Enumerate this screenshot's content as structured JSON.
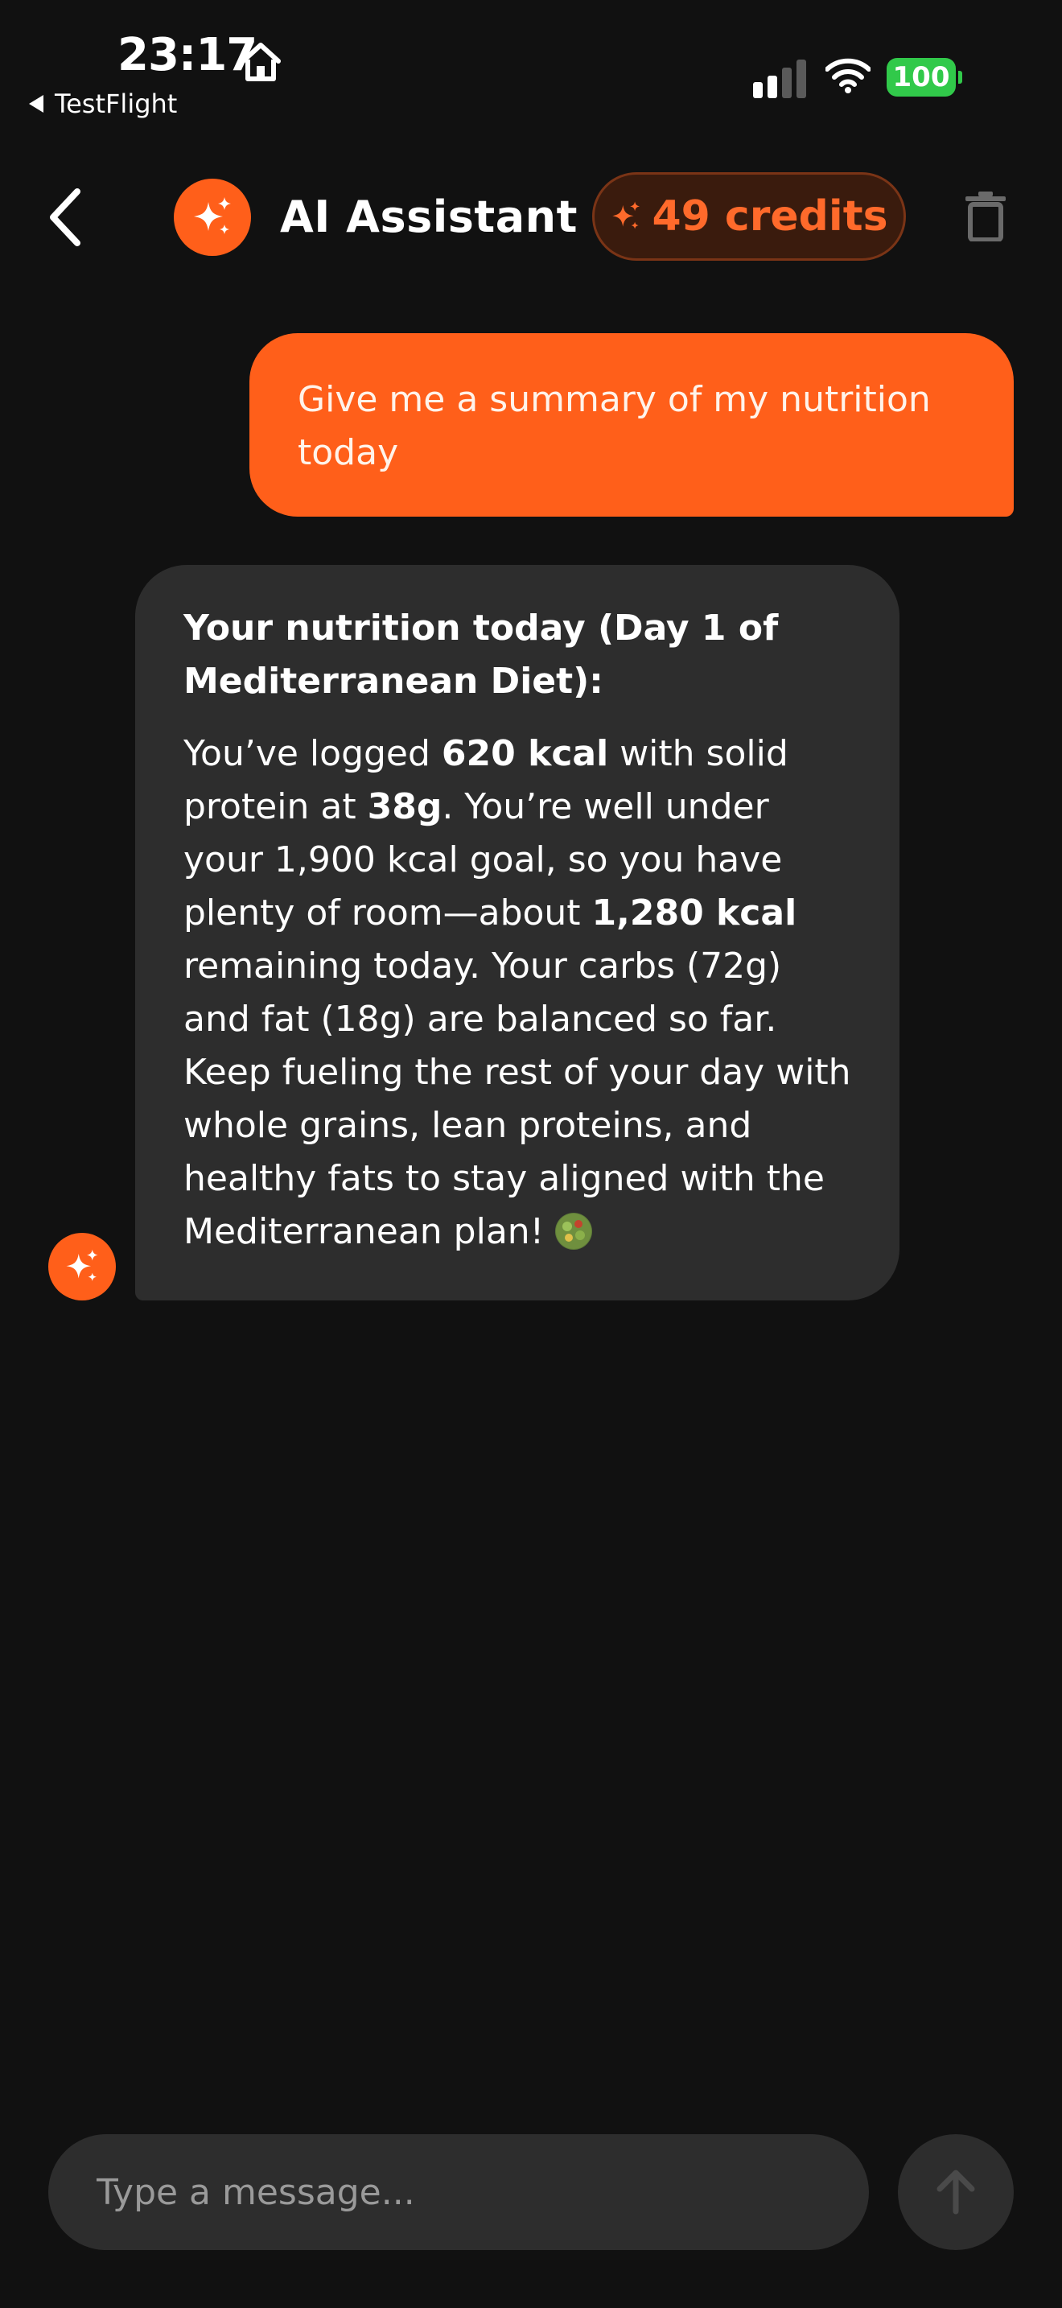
{
  "status_bar": {
    "time": "23:17",
    "back_app": "TestFlight",
    "battery": "100",
    "icons": [
      "home-icon",
      "signal-icon",
      "wifi-icon",
      "battery-icon"
    ]
  },
  "header": {
    "title": "AI Assistant",
    "credits": "49 credits",
    "icons": [
      "chevron-left-icon",
      "sparkle-icon",
      "trash-icon"
    ]
  },
  "messages": [
    {
      "role": "user",
      "text": "Give me a summary of my nutrition today"
    },
    {
      "role": "assistant",
      "heading": "Your nutrition today (Day 1 of Mediterranean Diet):",
      "body": {
        "p1": "You’ve logged ",
        "b1": "620 kcal",
        "p2": " with solid protein at ",
        "b2": "38g",
        "p3": ". You’re well under your 1,900 kcal goal, so you have plenty of room—about ",
        "b3": "1,280 kcal",
        "p4": " remaining today. Your carbs (72g) and fat (18g) are balanced so far. Keep fueling the rest of your day with whole grains, lean proteins, and healthy fats to stay aligned with the Mediterranean plan! ",
        "emoji": "salad-emoji"
      }
    }
  ],
  "composer": {
    "placeholder": "Type a message..."
  },
  "colors": {
    "accent": "#ff5f1a",
    "background": "#111111",
    "bubble_assistant": "#2d2d2d",
    "battery": "#31c94a"
  }
}
